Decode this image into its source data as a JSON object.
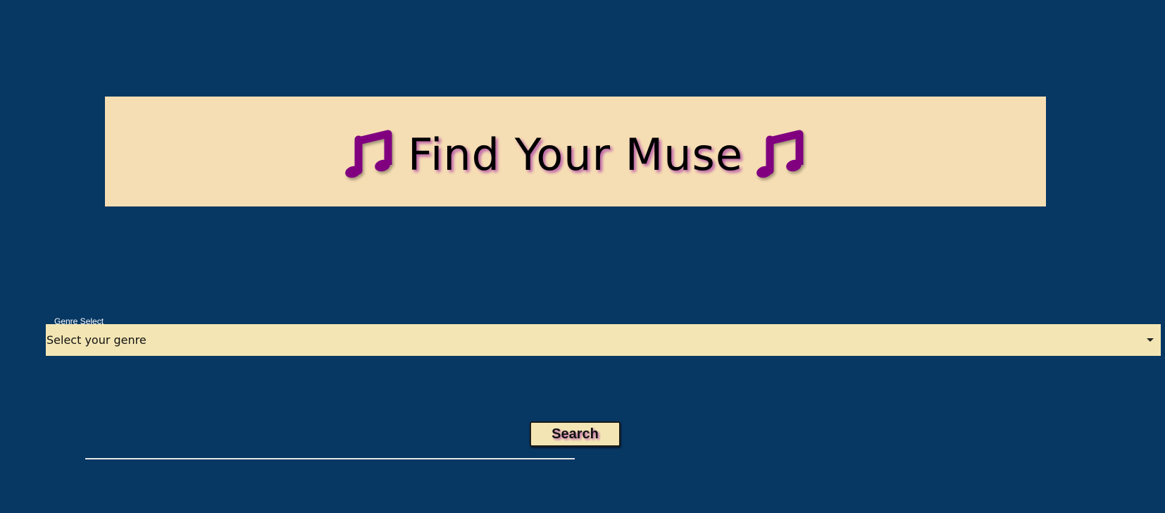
{
  "header": {
    "title": "Find Your Muse",
    "left_icon": "music-note-icon",
    "right_icon": "music-note-icon"
  },
  "form": {
    "genre_label": "Genre Select",
    "genre_selected": "Select your genre",
    "search_label": "Search"
  },
  "colors": {
    "background": "#073763",
    "banner": "#f6deb4",
    "select": "#f3e6b4",
    "note": "#800080",
    "title_shadow": "#b85aa8"
  }
}
